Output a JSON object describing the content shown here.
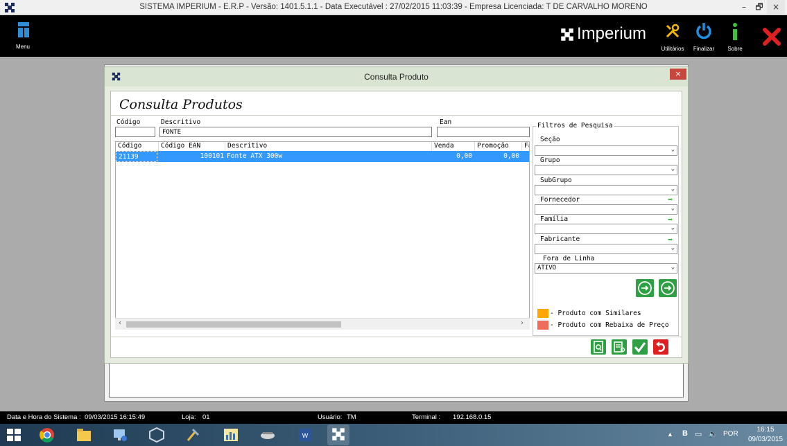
{
  "window": {
    "title": "SISTEMA IMPERIUM - E.R.P - Versão: 1401.5.1.1 - Data Executável : 27/02/2015 11:03:39 - Empresa Licenciada: T DE CARVALHO MORENO",
    "minimize": "–",
    "maximize": "🗗",
    "close": "×"
  },
  "toolbar": {
    "menu_label": "Menu",
    "brand": "Imperium",
    "utilities_label": "Utilitários",
    "finalize_label": "Finalizar",
    "about_label": "Sobre"
  },
  "dialog": {
    "title": "Consulta Produto",
    "close": "×",
    "heading": "Consulta Produtos",
    "search": {
      "codigo_label": "Código",
      "codigo_value": "",
      "descritivo_label": "Descritivo",
      "descritivo_value": "FONTE",
      "ean_label": "Ean",
      "ean_value": ""
    },
    "grid": {
      "columns": [
        "Código",
        "Código EAN",
        "Descritivo",
        "Venda",
        "Promoção",
        "Fa"
      ],
      "rows": [
        {
          "codigo": "21139",
          "ean": "100101",
          "descritivo": "Fonte ATX 300w",
          "venda": "0,00",
          "promocao": "0,00"
        }
      ]
    },
    "filters": {
      "legend": "Filtros de Pesquisa",
      "secao_label": "Seção",
      "secao_value": "",
      "grupo_label": "Grupo",
      "grupo_value": "",
      "subgrupo_label": "SubGrupo",
      "subgrupo_value": "",
      "fornecedor_label": "Fornecedor",
      "fornecedor_value": "",
      "familia_label": "Família",
      "familia_value": "",
      "fabricante_label": "Fabricante",
      "fabricante_value": "",
      "fora_linha_label": "Fora de Linha",
      "fora_linha_value": "ATIVO"
    },
    "legend_items": {
      "similares": "- Produto com Similares",
      "rebaixa": "- Produto com Rebaixa de Preço"
    },
    "colors": {
      "similares": "#ffa500",
      "rebaixa": "#f26c5c",
      "selection": "#3399ff",
      "accent_green": "#2ea043"
    }
  },
  "status": {
    "datetime_label": "Data e Hora do Sistema :",
    "datetime": "09/03/2015 16:15:49",
    "loja_label": "Loja:",
    "loja": "01",
    "usuario_label": "Usuário:",
    "usuario": "TM",
    "terminal_label": "Terminal :",
    "terminal": "192.168.0.15"
  },
  "taskbar": {
    "tray_lang": "POR",
    "tray_b": "B",
    "time": "16:15",
    "date": "09/03/2015"
  }
}
